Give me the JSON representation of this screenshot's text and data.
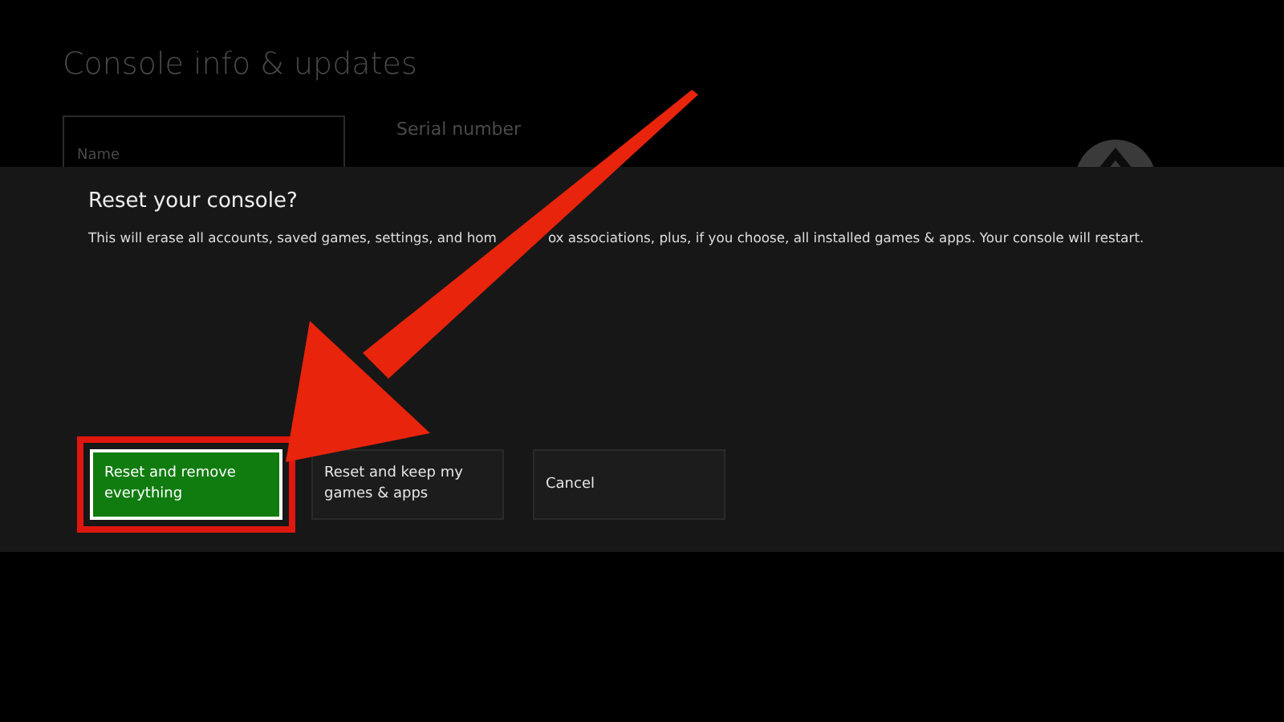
{
  "page": {
    "title": "Console info & updates"
  },
  "name_field": {
    "placeholder": "Name"
  },
  "serial": {
    "label": "Serial number"
  },
  "dialog": {
    "title": "Reset your console?",
    "description_parts": [
      "This will erase all accounts, saved games, settings, and hom",
      "ox associations, plus, if you choose, all installed games & apps. Your console will restart."
    ],
    "buttons": [
      {
        "label": "Reset and remove everything",
        "selected": true,
        "highlighted": true
      },
      {
        "label": "Reset and keep my games & apps",
        "selected": false,
        "highlighted": false
      },
      {
        "label": "Cancel",
        "selected": false,
        "highlighted": false
      }
    ]
  }
}
